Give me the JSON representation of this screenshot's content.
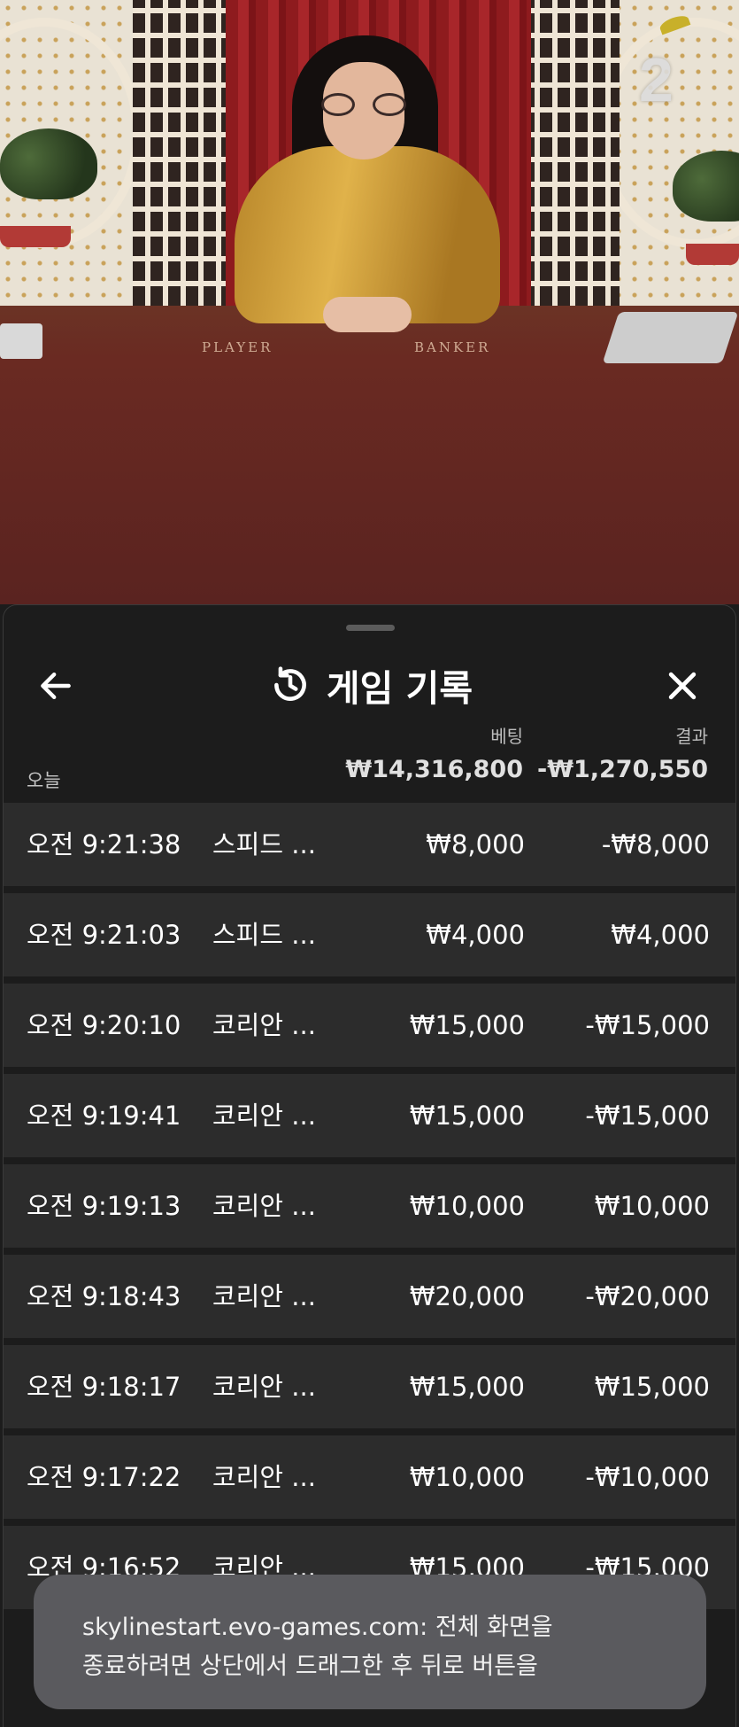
{
  "video": {
    "round_number": "2",
    "table_labels": {
      "player": "PLAYER",
      "banker": "BANKER"
    }
  },
  "sheet": {
    "title": "게임 기록",
    "icons": {
      "back": "arrow-left-icon",
      "history": "history-icon",
      "close": "close-icon"
    },
    "columns": {
      "bet": "베팅",
      "result": "결과"
    },
    "today": {
      "label": "오늘",
      "bet_total": "₩14,316,800",
      "result_total": "-₩1,270,550"
    },
    "rows": [
      {
        "time": "오전 9:21:38",
        "game": "스피드 ...",
        "bet": "₩8,000",
        "result": "-₩8,000"
      },
      {
        "time": "오전 9:21:03",
        "game": "스피드 ...",
        "bet": "₩4,000",
        "result": "₩4,000"
      },
      {
        "time": "오전 9:20:10",
        "game": "코리안 ...",
        "bet": "₩15,000",
        "result": "-₩15,000"
      },
      {
        "time": "오전 9:19:41",
        "game": "코리안 ...",
        "bet": "₩15,000",
        "result": "-₩15,000"
      },
      {
        "time": "오전 9:19:13",
        "game": "코리안 ...",
        "bet": "₩10,000",
        "result": "₩10,000"
      },
      {
        "time": "오전 9:18:43",
        "game": "코리안 ...",
        "bet": "₩20,000",
        "result": "-₩20,000"
      },
      {
        "time": "오전 9:18:17",
        "game": "코리안 ...",
        "bet": "₩15,000",
        "result": "₩15,000"
      },
      {
        "time": "오전 9:17:22",
        "game": "코리안 ...",
        "bet": "₩10,000",
        "result": "-₩10,000"
      },
      {
        "time": "오전 9:16:52",
        "game": "코리안 ...",
        "bet": "₩15,000",
        "result": "-₩15,000"
      }
    ]
  },
  "toast": {
    "line1": "skylinestart.evo-games.com: 전체 화면을",
    "line2": "종료하려면 상단에서 드래그한 후 뒤로 버튼을"
  }
}
